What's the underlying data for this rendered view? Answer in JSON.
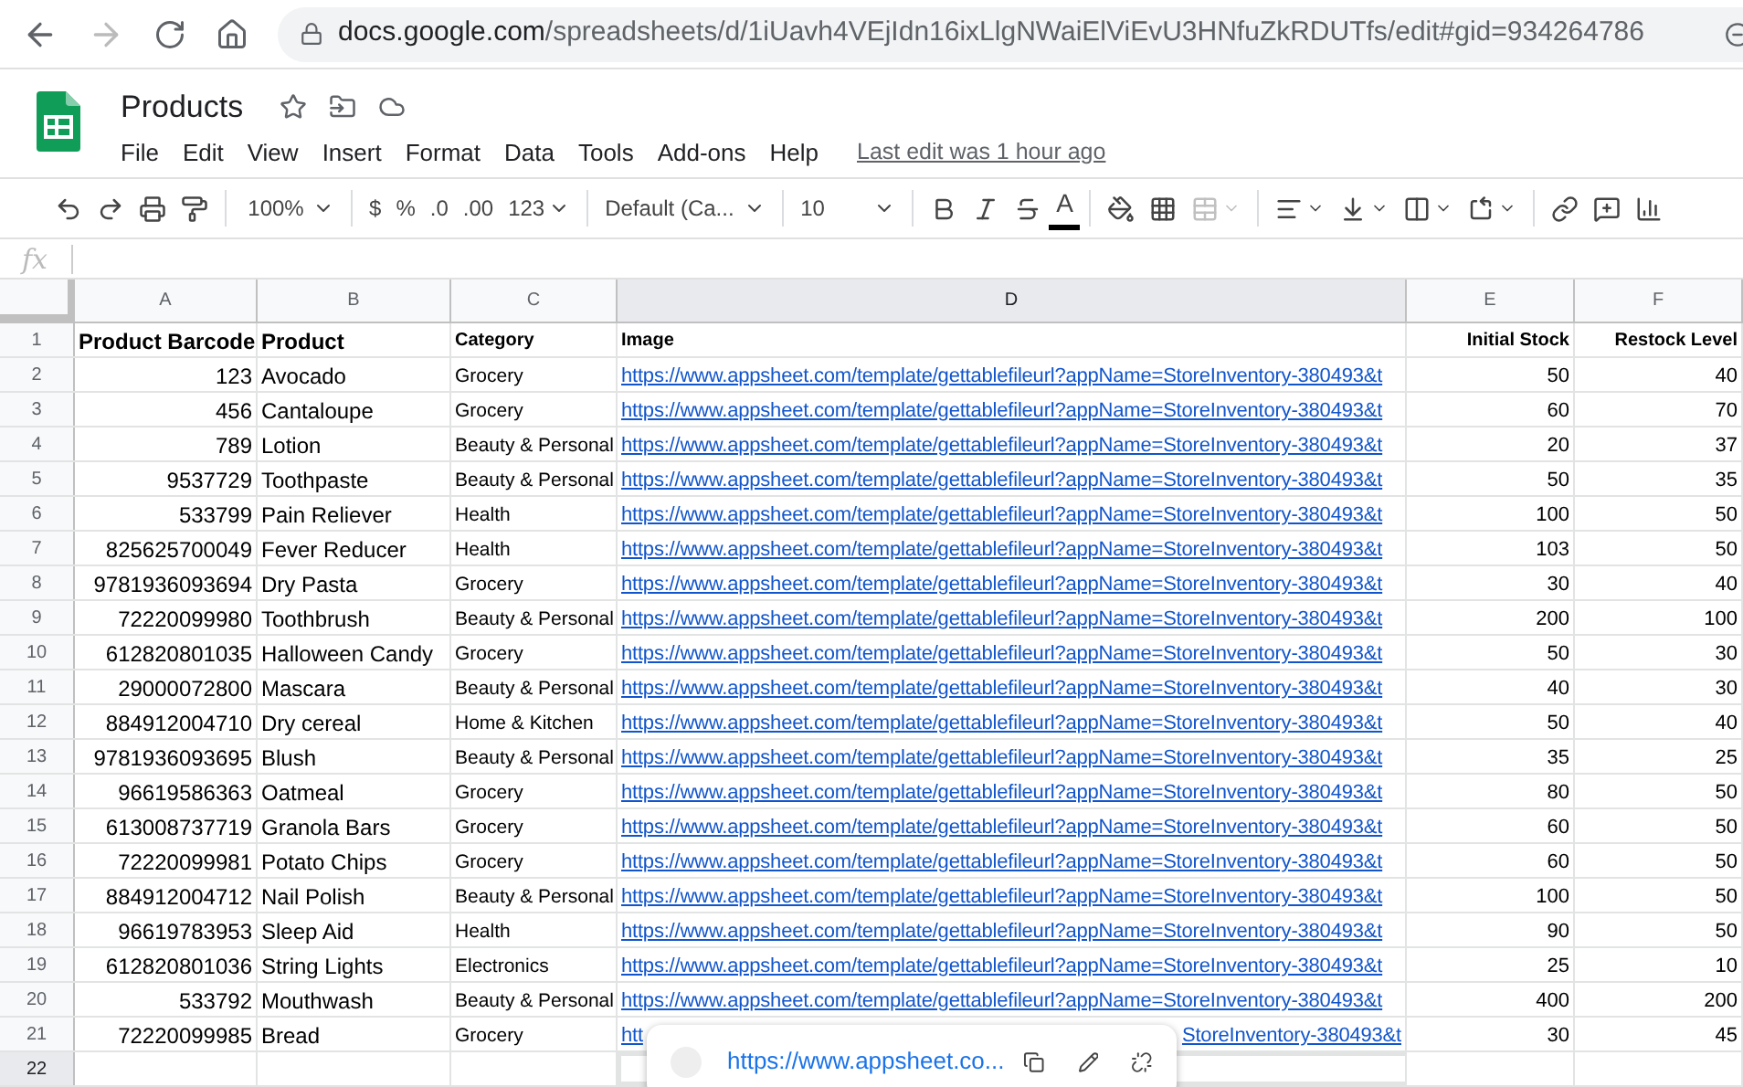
{
  "browser": {
    "host": "docs.google.com",
    "path": "/spreadsheets/d/1iUavh4VEjIdn16ixLlgNWaiElViEvU3HNfuZkRDUTfs/edit#gid=934264786"
  },
  "doc": {
    "title": "Products",
    "menu": [
      "File",
      "Edit",
      "View",
      "Insert",
      "Format",
      "Data",
      "Tools",
      "Add-ons",
      "Help"
    ],
    "last_edit": "Last edit was 1 hour ago"
  },
  "toolbar": {
    "zoom": "100%",
    "currency": "$",
    "percent": "%",
    "decrease_decimals": ".0",
    "increase_decimals": ".00",
    "number_format": "123",
    "font": "Default (Ca...",
    "font_size": "10",
    "text_color_letter": "A"
  },
  "formula_bar": {
    "label": "fx"
  },
  "columns": [
    {
      "label": "A",
      "selected": false
    },
    {
      "label": "B",
      "selected": false
    },
    {
      "label": "C",
      "selected": false
    },
    {
      "label": "D",
      "selected": true
    },
    {
      "label": "E",
      "selected": false
    },
    {
      "label": "F",
      "selected": false
    }
  ],
  "rows": [
    {
      "number": "1",
      "kind": "header",
      "selected": false,
      "cells": [
        "Product Barcode",
        "Product",
        "Category",
        "Image",
        "Initial Stock",
        "Restock Level"
      ]
    },
    {
      "number": "2",
      "kind": "data",
      "selected": false,
      "cells": [
        "123",
        "Avocado",
        "Grocery",
        "https://www.appsheet.com/template/gettablefileurl?appName=StoreInventory-380493&t",
        "50",
        "40"
      ]
    },
    {
      "number": "3",
      "kind": "data",
      "selected": false,
      "cells": [
        "456",
        "Cantaloupe",
        "Grocery",
        "https://www.appsheet.com/template/gettablefileurl?appName=StoreInventory-380493&t",
        "60",
        "70"
      ]
    },
    {
      "number": "4",
      "kind": "data",
      "selected": false,
      "cells": [
        "789",
        "Lotion",
        "Beauty & Personal",
        "https://www.appsheet.com/template/gettablefileurl?appName=StoreInventory-380493&t",
        "20",
        "37"
      ]
    },
    {
      "number": "5",
      "kind": "data",
      "selected": false,
      "cells": [
        "9537729",
        "Toothpaste",
        "Beauty & Personal",
        "https://www.appsheet.com/template/gettablefileurl?appName=StoreInventory-380493&t",
        "50",
        "35"
      ]
    },
    {
      "number": "6",
      "kind": "data",
      "selected": false,
      "cells": [
        "533799",
        "Pain Reliever",
        "Health",
        "https://www.appsheet.com/template/gettablefileurl?appName=StoreInventory-380493&t",
        "100",
        "50"
      ]
    },
    {
      "number": "7",
      "kind": "data",
      "selected": false,
      "cells": [
        "825625700049",
        "Fever Reducer",
        "Health",
        "https://www.appsheet.com/template/gettablefileurl?appName=StoreInventory-380493&t",
        "103",
        "50"
      ]
    },
    {
      "number": "8",
      "kind": "data",
      "selected": false,
      "cells": [
        "9781936093694",
        "Dry Pasta",
        "Grocery",
        "https://www.appsheet.com/template/gettablefileurl?appName=StoreInventory-380493&t",
        "30",
        "40"
      ]
    },
    {
      "number": "9",
      "kind": "data",
      "selected": false,
      "cells": [
        "72220099980",
        "Toothbrush",
        "Beauty & Personal",
        "https://www.appsheet.com/template/gettablefileurl?appName=StoreInventory-380493&t",
        "200",
        "100"
      ]
    },
    {
      "number": "10",
      "kind": "data",
      "selected": false,
      "cells": [
        "612820801035",
        "Halloween Candy",
        "Grocery",
        "https://www.appsheet.com/template/gettablefileurl?appName=StoreInventory-380493&t",
        "50",
        "30"
      ]
    },
    {
      "number": "11",
      "kind": "data",
      "selected": false,
      "cells": [
        "29000072800",
        "Mascara",
        "Beauty & Personal",
        "https://www.appsheet.com/template/gettablefileurl?appName=StoreInventory-380493&t",
        "40",
        "30"
      ]
    },
    {
      "number": "12",
      "kind": "data",
      "selected": false,
      "cells": [
        "884912004710",
        "Dry cereal",
        "Home & Kitchen",
        "https://www.appsheet.com/template/gettablefileurl?appName=StoreInventory-380493&t",
        "50",
        "40"
      ]
    },
    {
      "number": "13",
      "kind": "data",
      "selected": false,
      "cells": [
        "9781936093695",
        "Blush",
        "Beauty & Personal",
        "https://www.appsheet.com/template/gettablefileurl?appName=StoreInventory-380493&t",
        "35",
        "25"
      ]
    },
    {
      "number": "14",
      "kind": "data",
      "selected": false,
      "cells": [
        "96619586363",
        "Oatmeal",
        "Grocery",
        "https://www.appsheet.com/template/gettablefileurl?appName=StoreInventory-380493&t",
        "80",
        "50"
      ]
    },
    {
      "number": "15",
      "kind": "data",
      "selected": false,
      "cells": [
        "613008737719",
        "Granola Bars",
        "Grocery",
        "https://www.appsheet.com/template/gettablefileurl?appName=StoreInventory-380493&t",
        "60",
        "50"
      ]
    },
    {
      "number": "16",
      "kind": "data",
      "selected": false,
      "cells": [
        "72220099981",
        "Potato Chips",
        "Grocery",
        "https://www.appsheet.com/template/gettablefileurl?appName=StoreInventory-380493&t",
        "60",
        "50"
      ]
    },
    {
      "number": "17",
      "kind": "data",
      "selected": false,
      "cells": [
        "884912004712",
        "Nail Polish",
        "Beauty & Personal",
        "https://www.appsheet.com/template/gettablefileurl?appName=StoreInventory-380493&t",
        "100",
        "50"
      ]
    },
    {
      "number": "18",
      "kind": "data",
      "selected": false,
      "cells": [
        "96619783953",
        "Sleep Aid",
        "Health",
        "https://www.appsheet.com/template/gettablefileurl?appName=StoreInventory-380493&t",
        "90",
        "50"
      ]
    },
    {
      "number": "19",
      "kind": "data",
      "selected": false,
      "cells": [
        "612820801036",
        "String Lights",
        "Electronics",
        "https://www.appsheet.com/template/gettablefileurl?appName=StoreInventory-380493&t",
        "25",
        "10"
      ]
    },
    {
      "number": "20",
      "kind": "data",
      "selected": false,
      "cells": [
        "533792",
        "Mouthwash",
        "Beauty & Personal",
        "https://www.appsheet.com/template/gettablefileurl?appName=StoreInventory-380493&t",
        "400",
        "200"
      ]
    },
    {
      "number": "21",
      "kind": "data",
      "selected": false,
      "cells": [
        "72220099985",
        "Bread",
        "Grocery",
        [
          "htt",
          "StoreInventory-380493&t"
        ],
        "30",
        "45"
      ]
    },
    {
      "number": "22",
      "selected": true
    }
  ],
  "link_popup": {
    "url": "https://www.appsheet.co..."
  }
}
